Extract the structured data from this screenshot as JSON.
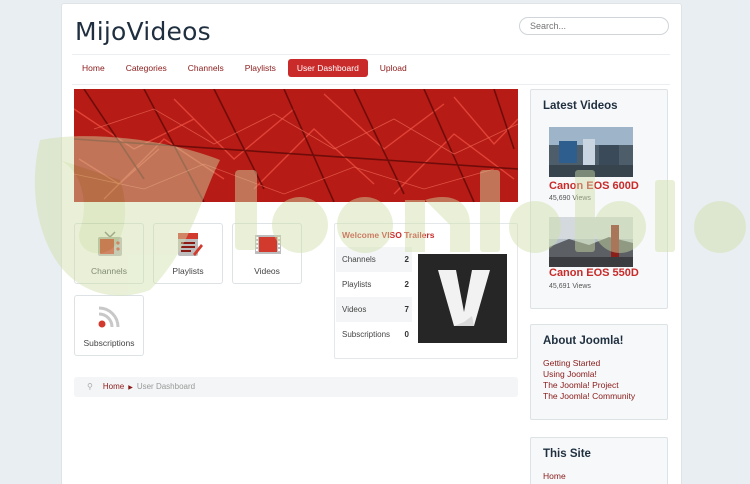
{
  "site": {
    "title": "MijoVideos"
  },
  "search": {
    "placeholder": "Search..."
  },
  "nav": {
    "items": [
      {
        "label": "Home"
      },
      {
        "label": "Categories"
      },
      {
        "label": "Channels"
      },
      {
        "label": "Playlists"
      },
      {
        "label": "User Dashboard",
        "active": true
      },
      {
        "label": "Upload"
      }
    ]
  },
  "dashboard": {
    "tiles": [
      {
        "label": "Channels",
        "icon": "channels-icon"
      },
      {
        "label": "Playlists",
        "icon": "playlists-icon"
      },
      {
        "label": "Videos",
        "icon": "videos-icon"
      },
      {
        "label": "Subscriptions",
        "icon": "subscriptions-icon"
      }
    ],
    "welcome": {
      "title": "Welcome VISO Trailers",
      "stats": [
        {
          "label": "Channels",
          "value": "2"
        },
        {
          "label": "Playlists",
          "value": "2"
        },
        {
          "label": "Videos",
          "value": "7"
        },
        {
          "label": "Subscriptions",
          "value": "0"
        }
      ]
    }
  },
  "breadcrumb": {
    "home": "Home",
    "current": "User Dashboard"
  },
  "sidebar": {
    "latest": {
      "title": "Latest Videos",
      "videos": [
        {
          "title": "Canon EOS 600D",
          "views": "45,690 Views"
        },
        {
          "title": "Canon EOS 550D",
          "views": "45,691 Views"
        }
      ]
    },
    "about": {
      "title": "About Joomla!",
      "links": [
        "Getting Started",
        "Using Joomla!",
        "The Joomla! Project",
        "The Joomla! Community"
      ]
    },
    "this_site": {
      "title": "This Site",
      "links": [
        "Home"
      ]
    }
  },
  "colors": {
    "accent": "#c92a2a",
    "link": "#8b1a1a",
    "heading": "#1f2f3f"
  }
}
